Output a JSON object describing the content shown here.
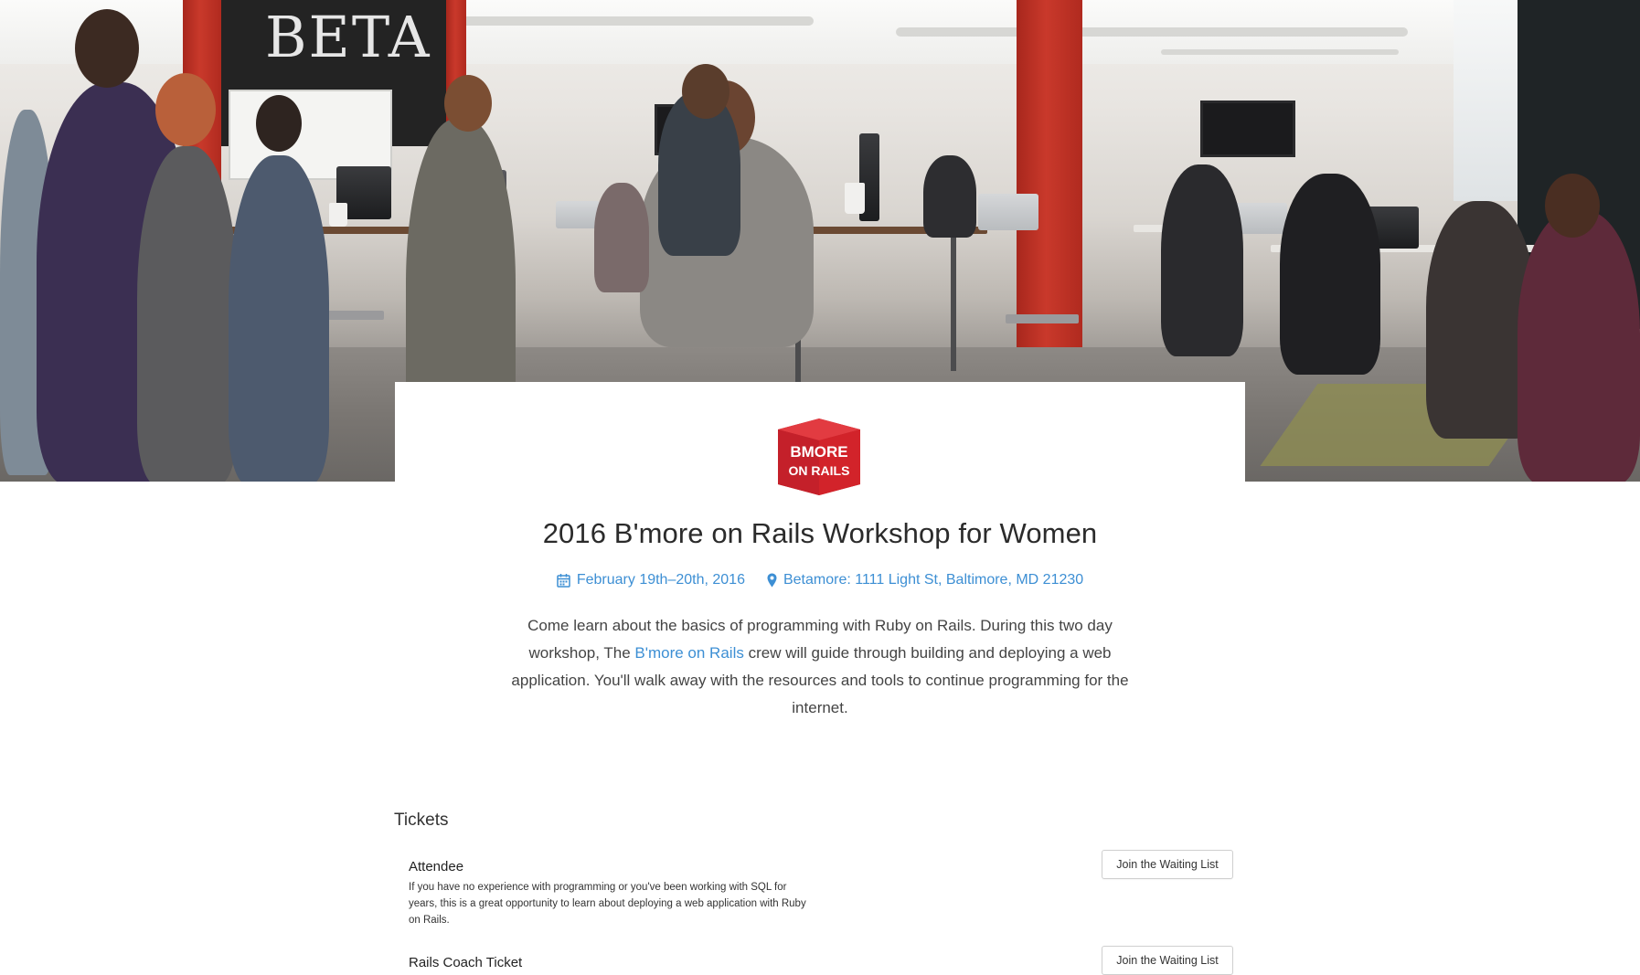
{
  "event": {
    "title": "2016 B'more on Rails Workshop for Women",
    "date": "February 19th–20th, 2016",
    "location": "Betamore: 1111 Light St, Baltimore, MD 21230",
    "description_before_link": "Come learn about the basics of programming with Ruby on Rails. During this two day workshop, The ",
    "description_link": "B'more on Rails",
    "description_after_link": " crew will guide through building and deploying a web application. You'll walk away with the resources and tools to continue programming for the internet."
  },
  "logo": {
    "line1": "BMORE",
    "line2": "ON RAILS",
    "color": "#d2232a"
  },
  "hero": {
    "chalkboard_text": "BETA"
  },
  "tickets": {
    "heading": "Tickets",
    "items": [
      {
        "name": "Attendee",
        "description": "If you have no experience with programming or you've been working with SQL for years, this is a great opportunity to learn about deploying a web application with Ruby on Rails.",
        "button_label": "Join the Waiting List"
      },
      {
        "name": "Rails Coach Ticket",
        "description": "",
        "button_label": "Join the Waiting List"
      }
    ]
  },
  "colors": {
    "link": "#3d8fd4",
    "brand_red": "#d2232a"
  },
  "icons": {
    "date": "calendar-icon",
    "location": "map-pin-icon"
  }
}
